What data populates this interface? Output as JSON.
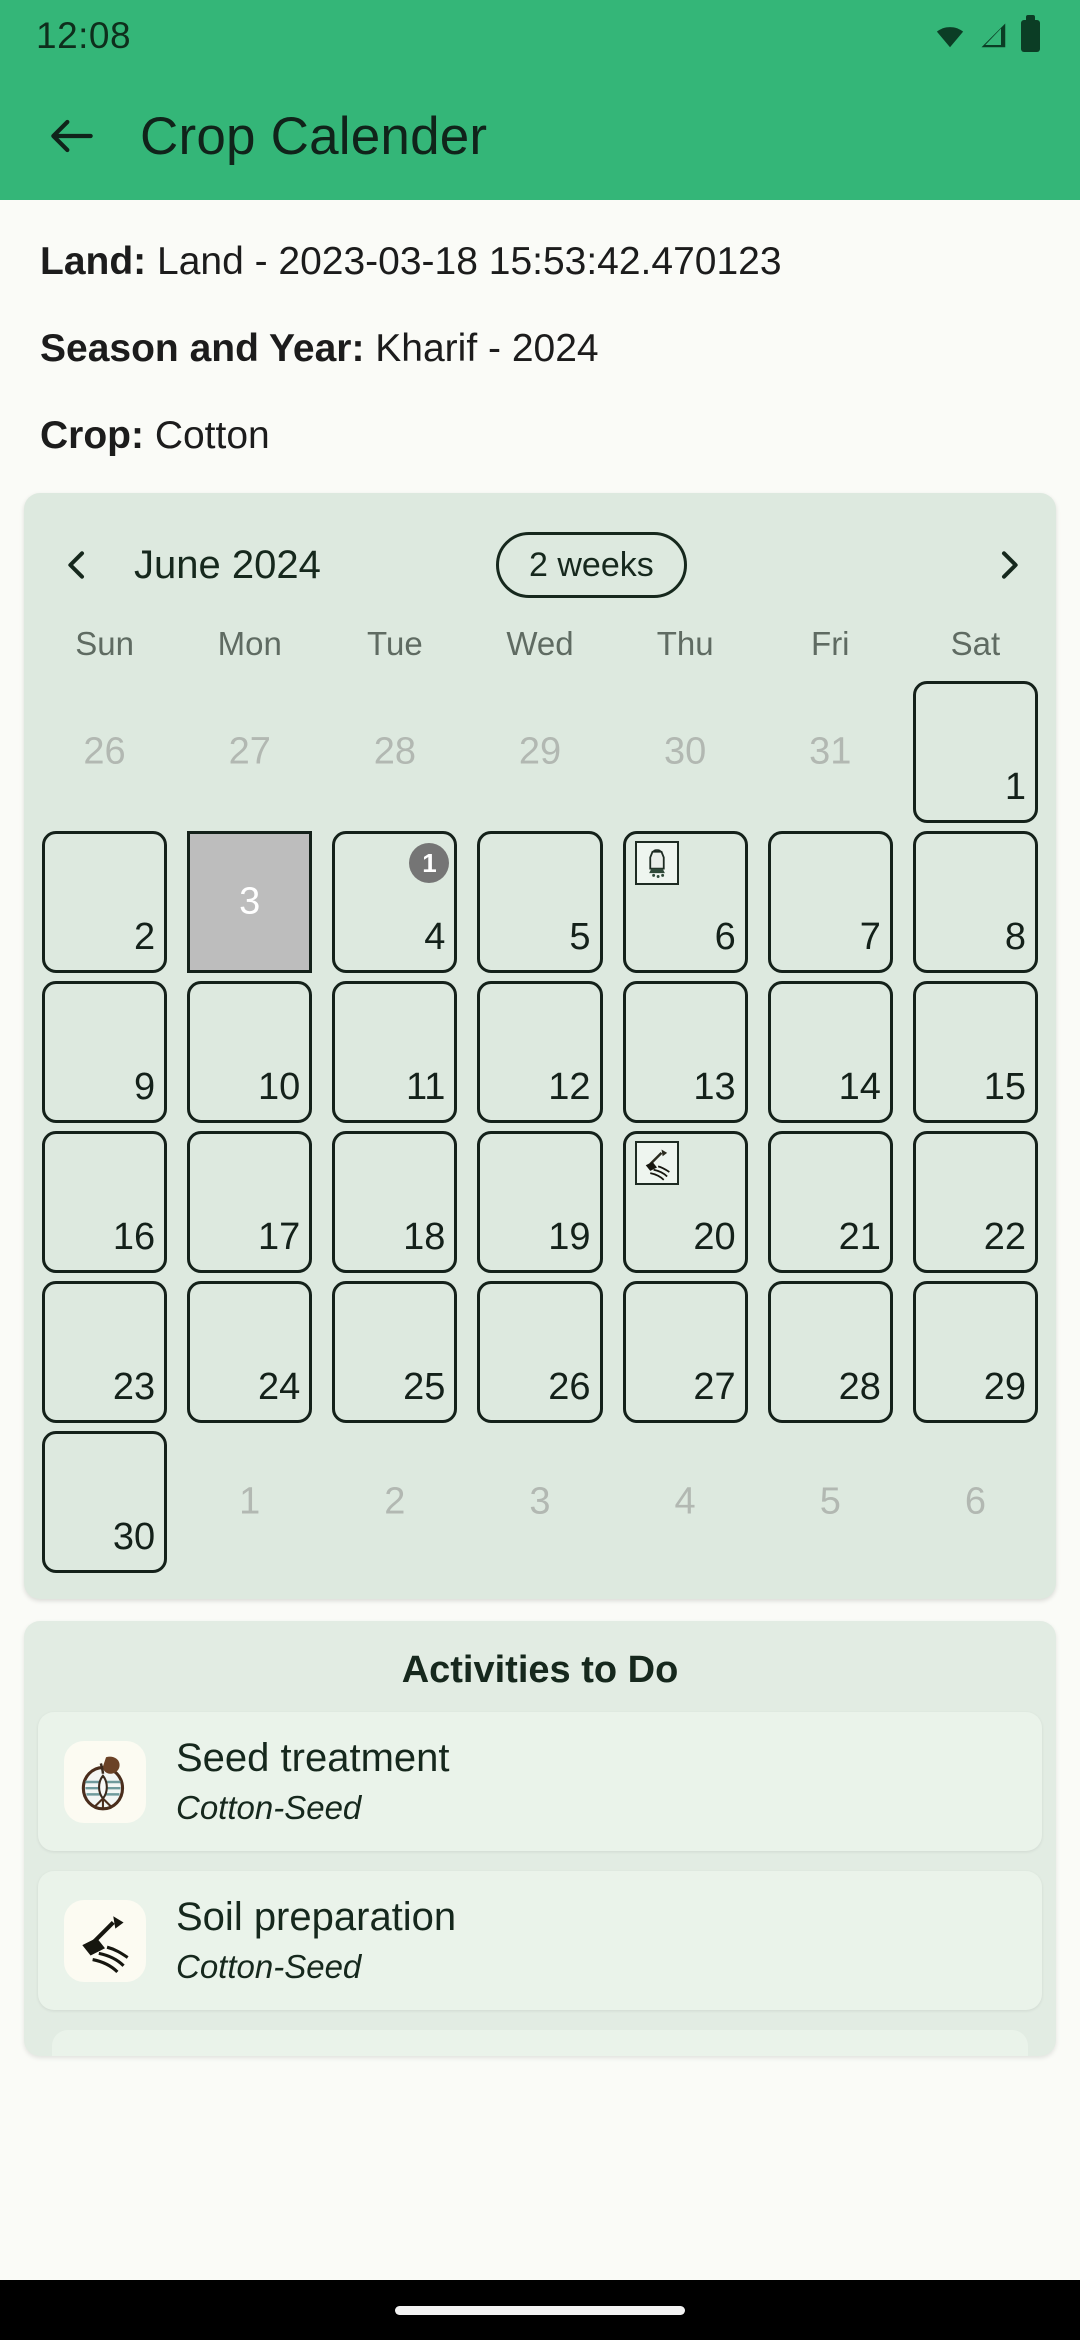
{
  "status_bar": {
    "time": "12:08",
    "icons": [
      "wifi-icon",
      "signal-icon",
      "battery-icon"
    ]
  },
  "app_bar": {
    "back_icon": "arrow-left-icon",
    "title": "Crop Calender"
  },
  "details": {
    "land_label": "Land:",
    "land_value": "Land - 2023-03-18 15:53:42.470123",
    "season_label": "Season and Year:",
    "season_value": "Kharif - 2024",
    "crop_label": "Crop:",
    "crop_value": "Cotton"
  },
  "calendar": {
    "prev_icon": "chevron-left-icon",
    "next_icon": "chevron-right-icon",
    "month": "June 2024",
    "range_chip": "2 weeks",
    "weekday_headers": [
      "Sun",
      "Mon",
      "Tue",
      "Wed",
      "Thu",
      "Fri",
      "Sat"
    ],
    "selected_day": 3,
    "weeks": [
      [
        {
          "num": "26",
          "out": true
        },
        {
          "num": "27",
          "out": true
        },
        {
          "num": "28",
          "out": true
        },
        {
          "num": "29",
          "out": true
        },
        {
          "num": "30",
          "out": true
        },
        {
          "num": "31",
          "out": true
        },
        {
          "num": "1",
          "out": false
        }
      ],
      [
        {
          "num": "2",
          "out": false
        },
        {
          "num": "3",
          "out": false,
          "selected": true
        },
        {
          "num": "4",
          "out": false,
          "badge": "1"
        },
        {
          "num": "5",
          "out": false
        },
        {
          "num": "6",
          "out": false,
          "icon": "seed-bag-icon"
        },
        {
          "num": "7",
          "out": false
        },
        {
          "num": "8",
          "out": false
        }
      ],
      [
        {
          "num": "9",
          "out": false
        },
        {
          "num": "10",
          "out": false
        },
        {
          "num": "11",
          "out": false
        },
        {
          "num": "12",
          "out": false
        },
        {
          "num": "13",
          "out": false
        },
        {
          "num": "14",
          "out": false
        },
        {
          "num": "15",
          "out": false
        }
      ],
      [
        {
          "num": "16",
          "out": false
        },
        {
          "num": "17",
          "out": false
        },
        {
          "num": "18",
          "out": false
        },
        {
          "num": "19",
          "out": false
        },
        {
          "num": "20",
          "out": false,
          "icon": "soil-prep-icon"
        },
        {
          "num": "21",
          "out": false
        },
        {
          "num": "22",
          "out": false
        }
      ],
      [
        {
          "num": "23",
          "out": false
        },
        {
          "num": "24",
          "out": false
        },
        {
          "num": "25",
          "out": false
        },
        {
          "num": "26",
          "out": false
        },
        {
          "num": "27",
          "out": false
        },
        {
          "num": "28",
          "out": false
        },
        {
          "num": "29",
          "out": false
        }
      ],
      [
        {
          "num": "30",
          "out": false
        },
        {
          "num": "1",
          "out": true
        },
        {
          "num": "2",
          "out": true
        },
        {
          "num": "3",
          "out": true
        },
        {
          "num": "4",
          "out": true
        },
        {
          "num": "5",
          "out": true
        },
        {
          "num": "6",
          "out": true
        }
      ]
    ]
  },
  "activities": {
    "title": "Activities to Do",
    "items": [
      {
        "icon": "seed-treatment-icon",
        "name": "Seed treatment",
        "sub": "Cotton-Seed"
      },
      {
        "icon": "soil-preparation-icon",
        "name": "Soil preparation",
        "sub": "Cotton-Seed"
      }
    ]
  },
  "colors": {
    "brand_green": "#34b678",
    "card_green": "#dde9df",
    "selected_grey": "#bdbdbd",
    "badge_grey": "#757575"
  },
  "nav_bar": {
    "pill": "home-indicator"
  }
}
